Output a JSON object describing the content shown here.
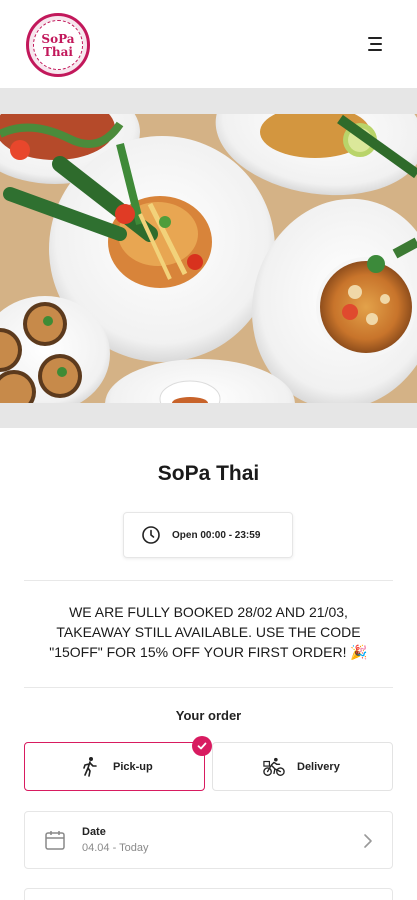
{
  "header": {
    "logo_line1": "SoPa",
    "logo_line2": "Thai"
  },
  "restaurant": {
    "name": "SoPa Thai",
    "hours": "Open 00:00 - 23:59"
  },
  "notice": "WE ARE FULLY BOOKED 28/02 AND 21/03, TAKEAWAY STILL AVAILABLE. USE THE CODE \"15OFF\" FOR 15% OFF YOUR FIRST ORDER! 🎉",
  "order": {
    "heading": "Your order",
    "modes": [
      {
        "label": "Pick-up",
        "selected": true
      },
      {
        "label": "Delivery",
        "selected": false
      }
    ],
    "date": {
      "label": "Date",
      "value": "04.04 - Today"
    }
  },
  "colors": {
    "accent": "#d81b60",
    "border": "#e6e6e6"
  },
  "icons": [
    "menu-icon",
    "clock-icon",
    "walking-icon",
    "bicycle-icon",
    "calendar-icon",
    "chevron-right-icon",
    "check-icon"
  ]
}
